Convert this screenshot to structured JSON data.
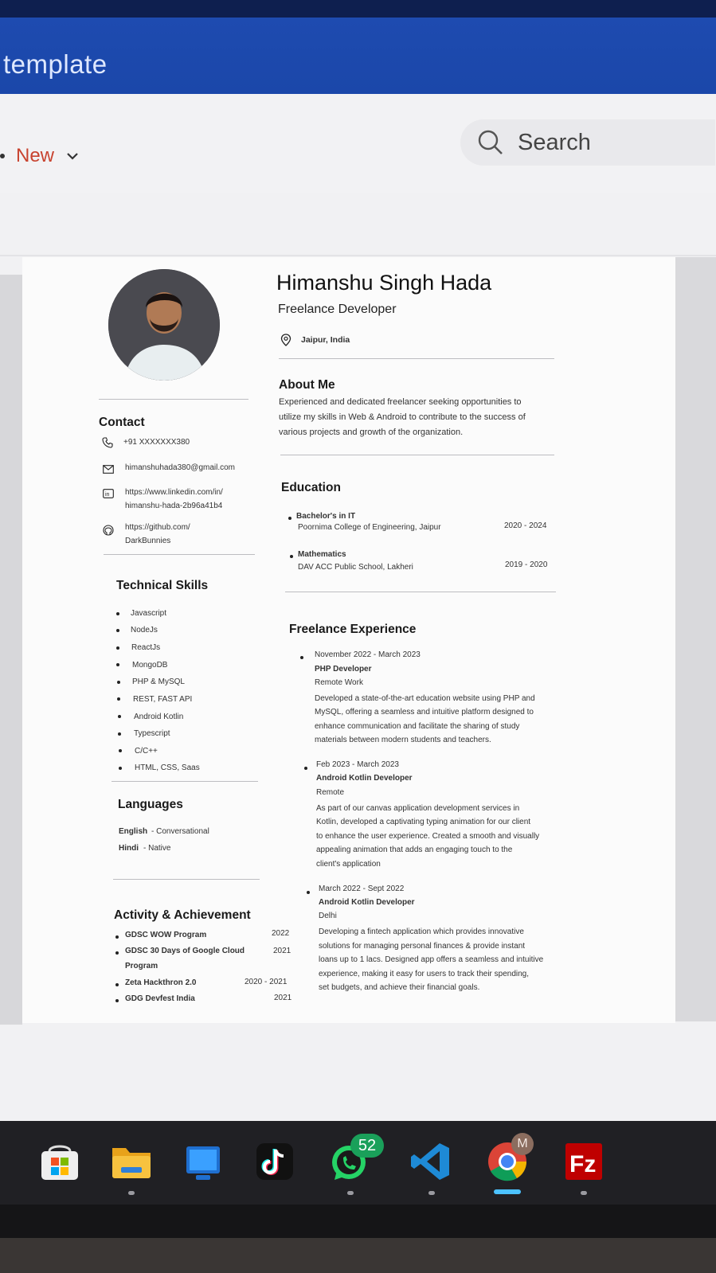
{
  "window": {
    "title": "template"
  },
  "toolbar": {
    "new_label": "New",
    "search_placeholder": "Search"
  },
  "resume": {
    "name": "Himanshu Singh Hada",
    "role": "Freelance Developer",
    "location": "Jaipur, India",
    "about": {
      "heading": "About Me",
      "lines": [
        "Experienced and dedicated freelancer seeking opportunities to",
        "utilize my skills in Web & Android to contribute to the success of",
        "various projects and growth of the organization."
      ]
    },
    "contact": {
      "heading": "Contact",
      "phone": "+91 XXXXXXX380",
      "email": "himanshuhada380@gmail.com",
      "linkedin_1": "https://www.linkedin.com/in/",
      "linkedin_2": "himanshu-hada-2b96a41b4",
      "github_1": "https://github.com/",
      "github_2": "DarkBunnies"
    },
    "skills": {
      "heading": "Technical Skills",
      "items": [
        "Javascript",
        "NodeJs",
        "ReactJs",
        "MongoDB",
        "PHP & MySQL",
        "REST, FAST API",
        "Android Kotlin",
        "Typescript",
        "C/C++",
        "HTML, CSS, Saas"
      ]
    },
    "languages": {
      "heading": "Languages",
      "items": [
        {
          "name": "English",
          "level": "- Conversational"
        },
        {
          "name": "Hindi",
          "level": "- Native"
        }
      ]
    },
    "activity": {
      "heading": "Activity & Achievement",
      "items": [
        {
          "label": "GDSC WOW Program",
          "label2": "",
          "year": "2022"
        },
        {
          "label": "GDSC 30 Days of Google Cloud",
          "label2": "Program",
          "year": "2021"
        },
        {
          "label": "Zeta Hackthron 2.0",
          "label2": "",
          "year": "2020 - 2021"
        },
        {
          "label": "GDG Devfest India",
          "label2": "",
          "year": "2021"
        }
      ]
    },
    "education": {
      "heading": "Education",
      "items": [
        {
          "degree": "Bachelor's in IT",
          "school": "Poornima College of Engineering, Jaipur",
          "years": "2020 - 2024"
        },
        {
          "degree": "Mathematics",
          "school": "DAV ACC Public School, Lakheri",
          "years": "2019 - 2020"
        }
      ]
    },
    "experience": {
      "heading": "Freelance Experience",
      "items": [
        {
          "dates": "November 2022 - March 2023",
          "title": "PHP Developer",
          "place": "Remote Work",
          "lines": [
            "Developed a state-of-the-art education website using PHP and",
            "MySQL, offering a seamless and intuitive platform designed to",
            "enhance communication and facilitate the sharing of study",
            "materials between modern students and teachers."
          ]
        },
        {
          "dates": "Feb 2023 - March 2023",
          "title": "Android Kotlin Developer",
          "place": "Remote",
          "lines": [
            "As part of our canvas application development services in",
            "Kotlin, developed a captivating typing animation for our client",
            "to enhance the user experience. Created a smooth and visually",
            "appealing animation that adds an engaging touch to the",
            "client's application"
          ]
        },
        {
          "dates": "March 2022 - Sept 2022",
          "title": "Android Kotlin Developer",
          "place": "Delhi",
          "lines": [
            "Developing a fintech application which provides innovative",
            "solutions for managing personal finances & provide instant",
            "loans up to 1 lacs. Designed app offers a seamless and intuitive",
            "experience, making it easy for users to track their spending,",
            "set budgets, and achieve their financial goals."
          ]
        }
      ]
    }
  },
  "taskbar": {
    "whatsapp_badge": "52",
    "chrome_profile": "M",
    "icons": [
      "store-icon",
      "file-explorer-icon",
      "app-window-icon",
      "tiktok-icon",
      "whatsapp-icon",
      "vscode-icon",
      "chrome-icon",
      "filezilla-icon"
    ]
  }
}
